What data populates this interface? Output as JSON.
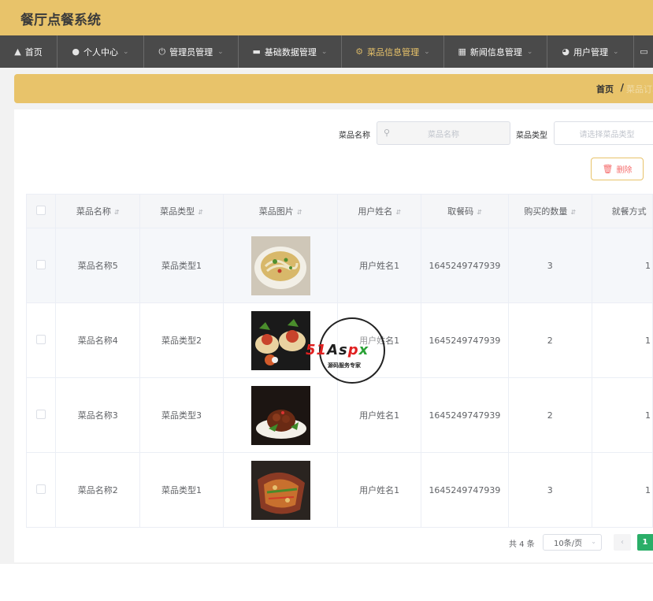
{
  "app": {
    "title": "餐厅点餐系统"
  },
  "nav": {
    "items": [
      {
        "label": "首页",
        "icon": "home-icon",
        "active": false
      },
      {
        "label": "个人中心",
        "icon": "user-icon",
        "active": false
      },
      {
        "label": "管理员管理",
        "icon": "power-icon",
        "active": false
      },
      {
        "label": "基础数据管理",
        "icon": "monitor-icon",
        "active": false
      },
      {
        "label": "菜品信息管理",
        "icon": "gear-icon",
        "active": true
      },
      {
        "label": "新闻信息管理",
        "icon": "grid-icon",
        "active": false
      },
      {
        "label": "用户管理",
        "icon": "dashboard-icon",
        "active": false
      }
    ]
  },
  "breadcrumb": {
    "home": "首页",
    "separator": "/",
    "current": "菜品订单"
  },
  "search": {
    "name_label": "菜品名称",
    "name_placeholder": "菜品名称",
    "type_label": "菜品类型",
    "type_placeholder": "请选择菜品类型"
  },
  "actions": {
    "delete_label": "删除"
  },
  "table": {
    "columns": [
      "菜品名称",
      "菜品类型",
      "菜品图片",
      "用户姓名",
      "取餐码",
      "购买的数量",
      "就餐方式"
    ],
    "rows": [
      {
        "name": "菜品名称5",
        "type": "菜品类型1",
        "image": "noodle-bowl",
        "user": "用户姓名1",
        "code": "1645249747939",
        "qty": "3",
        "extra": "1"
      },
      {
        "name": "菜品名称4",
        "type": "菜品类型2",
        "image": "pudding-cups",
        "user": "用户姓名1",
        "code": "1645249747939",
        "qty": "2",
        "extra": "1"
      },
      {
        "name": "菜品名称3",
        "type": "菜品类型3",
        "image": "braised-meat",
        "user": "用户姓名1",
        "code": "1645249747939",
        "qty": "2",
        "extra": "1"
      },
      {
        "name": "菜品名称2",
        "type": "菜品类型1",
        "image": "fish-dish",
        "user": "用户姓名1",
        "code": "1645249747939",
        "qty": "3",
        "extra": "1"
      }
    ]
  },
  "pagination": {
    "total_text": "共 4 条",
    "page_size": "10条/页",
    "current_page": "1"
  },
  "watermark": {
    "brand_51": "51",
    "brand_as": "As",
    "brand_p": "p",
    "brand_x": "x",
    "subtitle": "源码服务专家"
  },
  "colors": {
    "accent": "#e8c36a",
    "nav_bg": "#4a4a4a",
    "danger": "#f56c6c",
    "pager_active": "#2aae68"
  }
}
